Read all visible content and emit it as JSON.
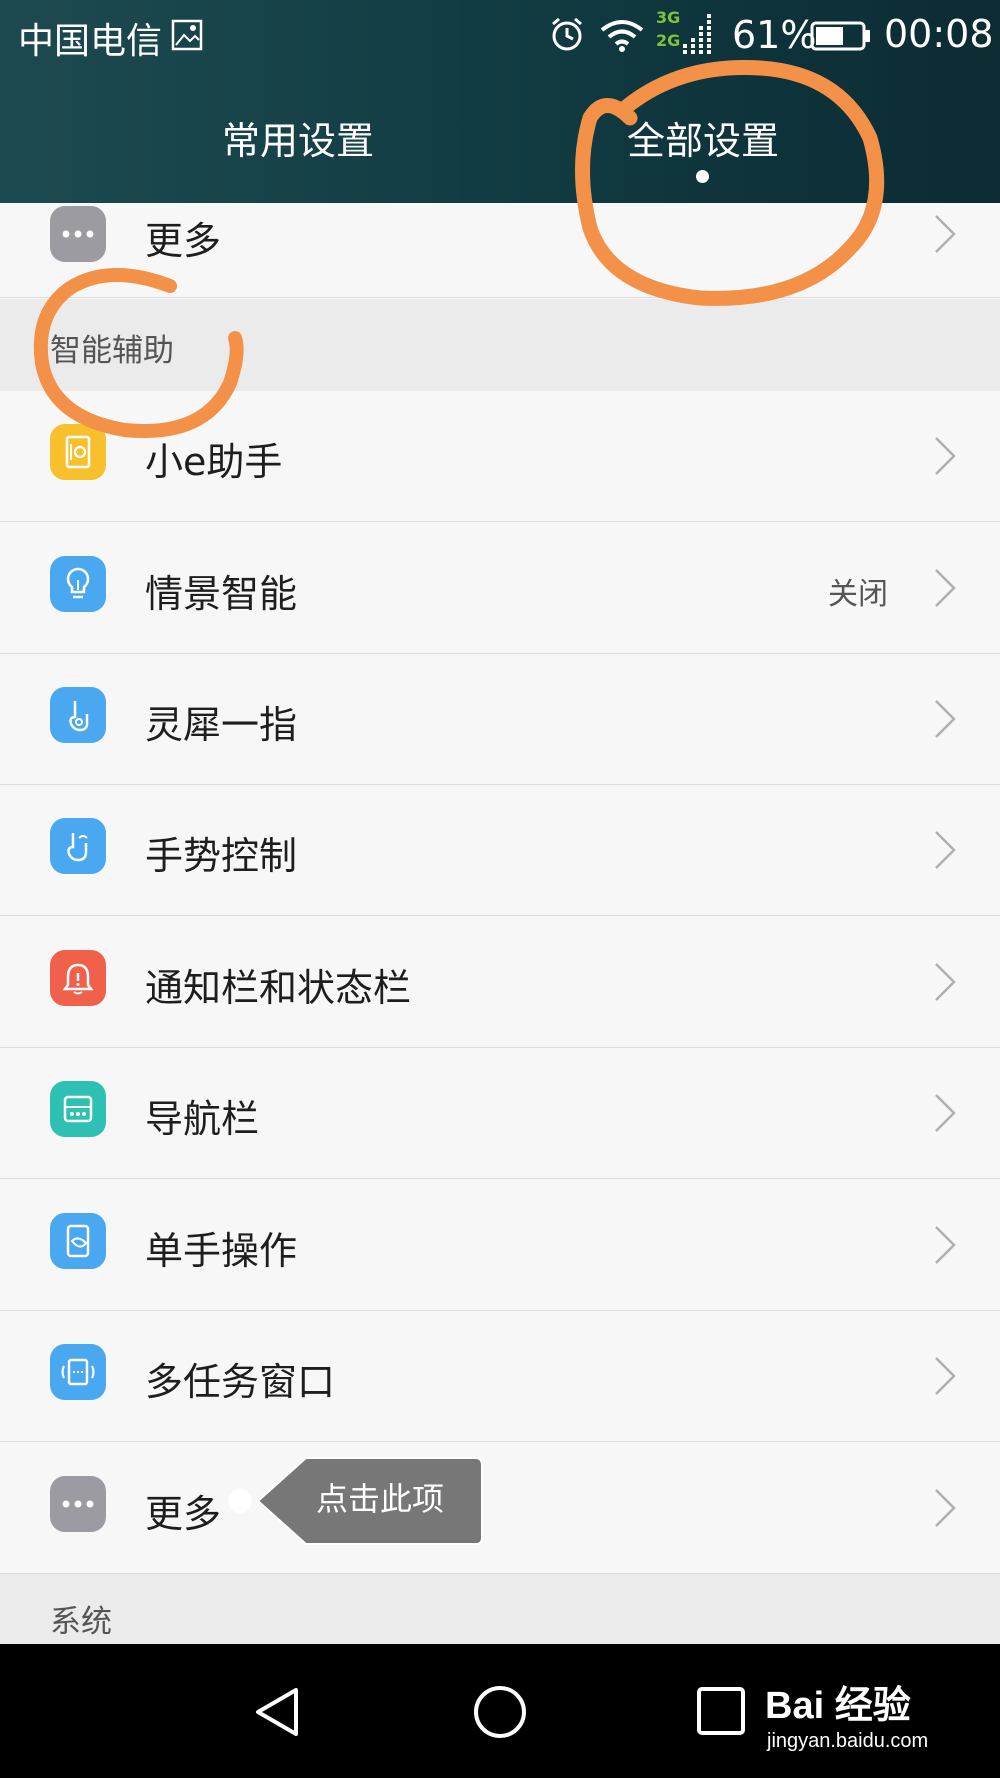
{
  "status_bar": {
    "carrier": "中国电信",
    "net_3g": "3G",
    "net_2g": "2G",
    "battery_percent": "61%",
    "battery_level": 0.61,
    "time": "00:08"
  },
  "tabs": [
    {
      "label": "常用设置",
      "active": false
    },
    {
      "label": "全部设置",
      "active": true
    }
  ],
  "list": {
    "top_item": {
      "label": "更多",
      "icon": "more-icon"
    },
    "section_assist": "智能辅助",
    "items": [
      {
        "label": "小e助手",
        "icon": "assistant-icon",
        "color": "#f9c02e"
      },
      {
        "label": "情景智能",
        "icon": "lightbulb-icon",
        "color": "#4aa8f0",
        "value": "关闭"
      },
      {
        "label": "灵犀一指",
        "icon": "knuckle-icon",
        "color": "#4aa8f0"
      },
      {
        "label": "手势控制",
        "icon": "gesture-icon",
        "color": "#4aa8f0"
      },
      {
        "label": "通知栏和状态栏",
        "icon": "bell-icon",
        "color": "#f0604a"
      },
      {
        "label": "导航栏",
        "icon": "navigation-icon",
        "color": "#2ec1b3"
      },
      {
        "label": "单手操作",
        "icon": "one-hand-icon",
        "color": "#4aa8f0"
      },
      {
        "label": "多任务窗口",
        "icon": "multi-window-icon",
        "color": "#4aa8f0"
      },
      {
        "label": "更多",
        "icon": "more-icon",
        "color": "#9b9ba1"
      }
    ],
    "section_system": "系统"
  },
  "tooltip": {
    "text": "点击此项"
  },
  "annotation_color": "#f39148",
  "watermark": {
    "logo": "Bai 经验",
    "url": "jingyan.baidu.com"
  }
}
